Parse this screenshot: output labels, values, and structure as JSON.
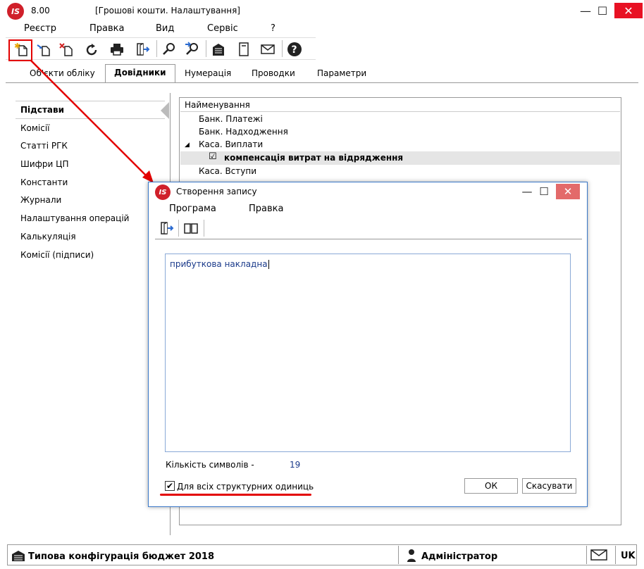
{
  "app": {
    "version": "8.00",
    "window_title": "[Грошові кошти. Налаштування]",
    "logo_text": "IS"
  },
  "menu": [
    "Реєстр",
    "Правка",
    "Вид",
    "Сервіс",
    "?"
  ],
  "toolbar": {
    "icons": [
      "new-record-icon",
      "copy-record-icon",
      "delete-record-icon",
      "refresh-icon",
      "print-icon",
      "exit-icon",
      "find-icon",
      "find-next-icon",
      "building-icon",
      "document-icon",
      "mail-icon",
      "help-icon"
    ]
  },
  "tabs": [
    "Об'єкти обліку",
    "Довідники",
    "Нумерація",
    "Проводки",
    "Параметри"
  ],
  "active_tab": "Довідники",
  "left_list": [
    "Підстави",
    "Комісії",
    "Статті РГК",
    "Шифри ЦП",
    "Константи",
    "Журнали",
    "Налаштування операцій",
    "Калькуляція",
    "Комісії (підписи)"
  ],
  "table": {
    "column_header": "Найменування",
    "rows": [
      "Банк. Платежі",
      "Банк. Надходження",
      "Каса. Виплати",
      "компенсація витрат на відрядження",
      "Каса. Вступи"
    ],
    "expanded_marker": "◢",
    "checked_marker": "☑"
  },
  "dialog": {
    "logo_text": "IS",
    "title": "Створення запису",
    "menu": [
      "Програма",
      "Правка"
    ],
    "text_value": "прибуткова накладна",
    "char_count_label": "Кількість символів -",
    "char_count_value": "19",
    "checkbox_label": "Для всіх структурних одиниць",
    "checkbox_checked": true,
    "ok_label": "ОК",
    "cancel_label": "Скасувати"
  },
  "statusbar": {
    "config": "Типова конфігурація бюджет 2018",
    "user": "Адміністратор",
    "lang": "UK"
  },
  "colors": {
    "annotation_red": "#e30000",
    "close_red": "#e81123",
    "logo_red": "#d0202a"
  }
}
